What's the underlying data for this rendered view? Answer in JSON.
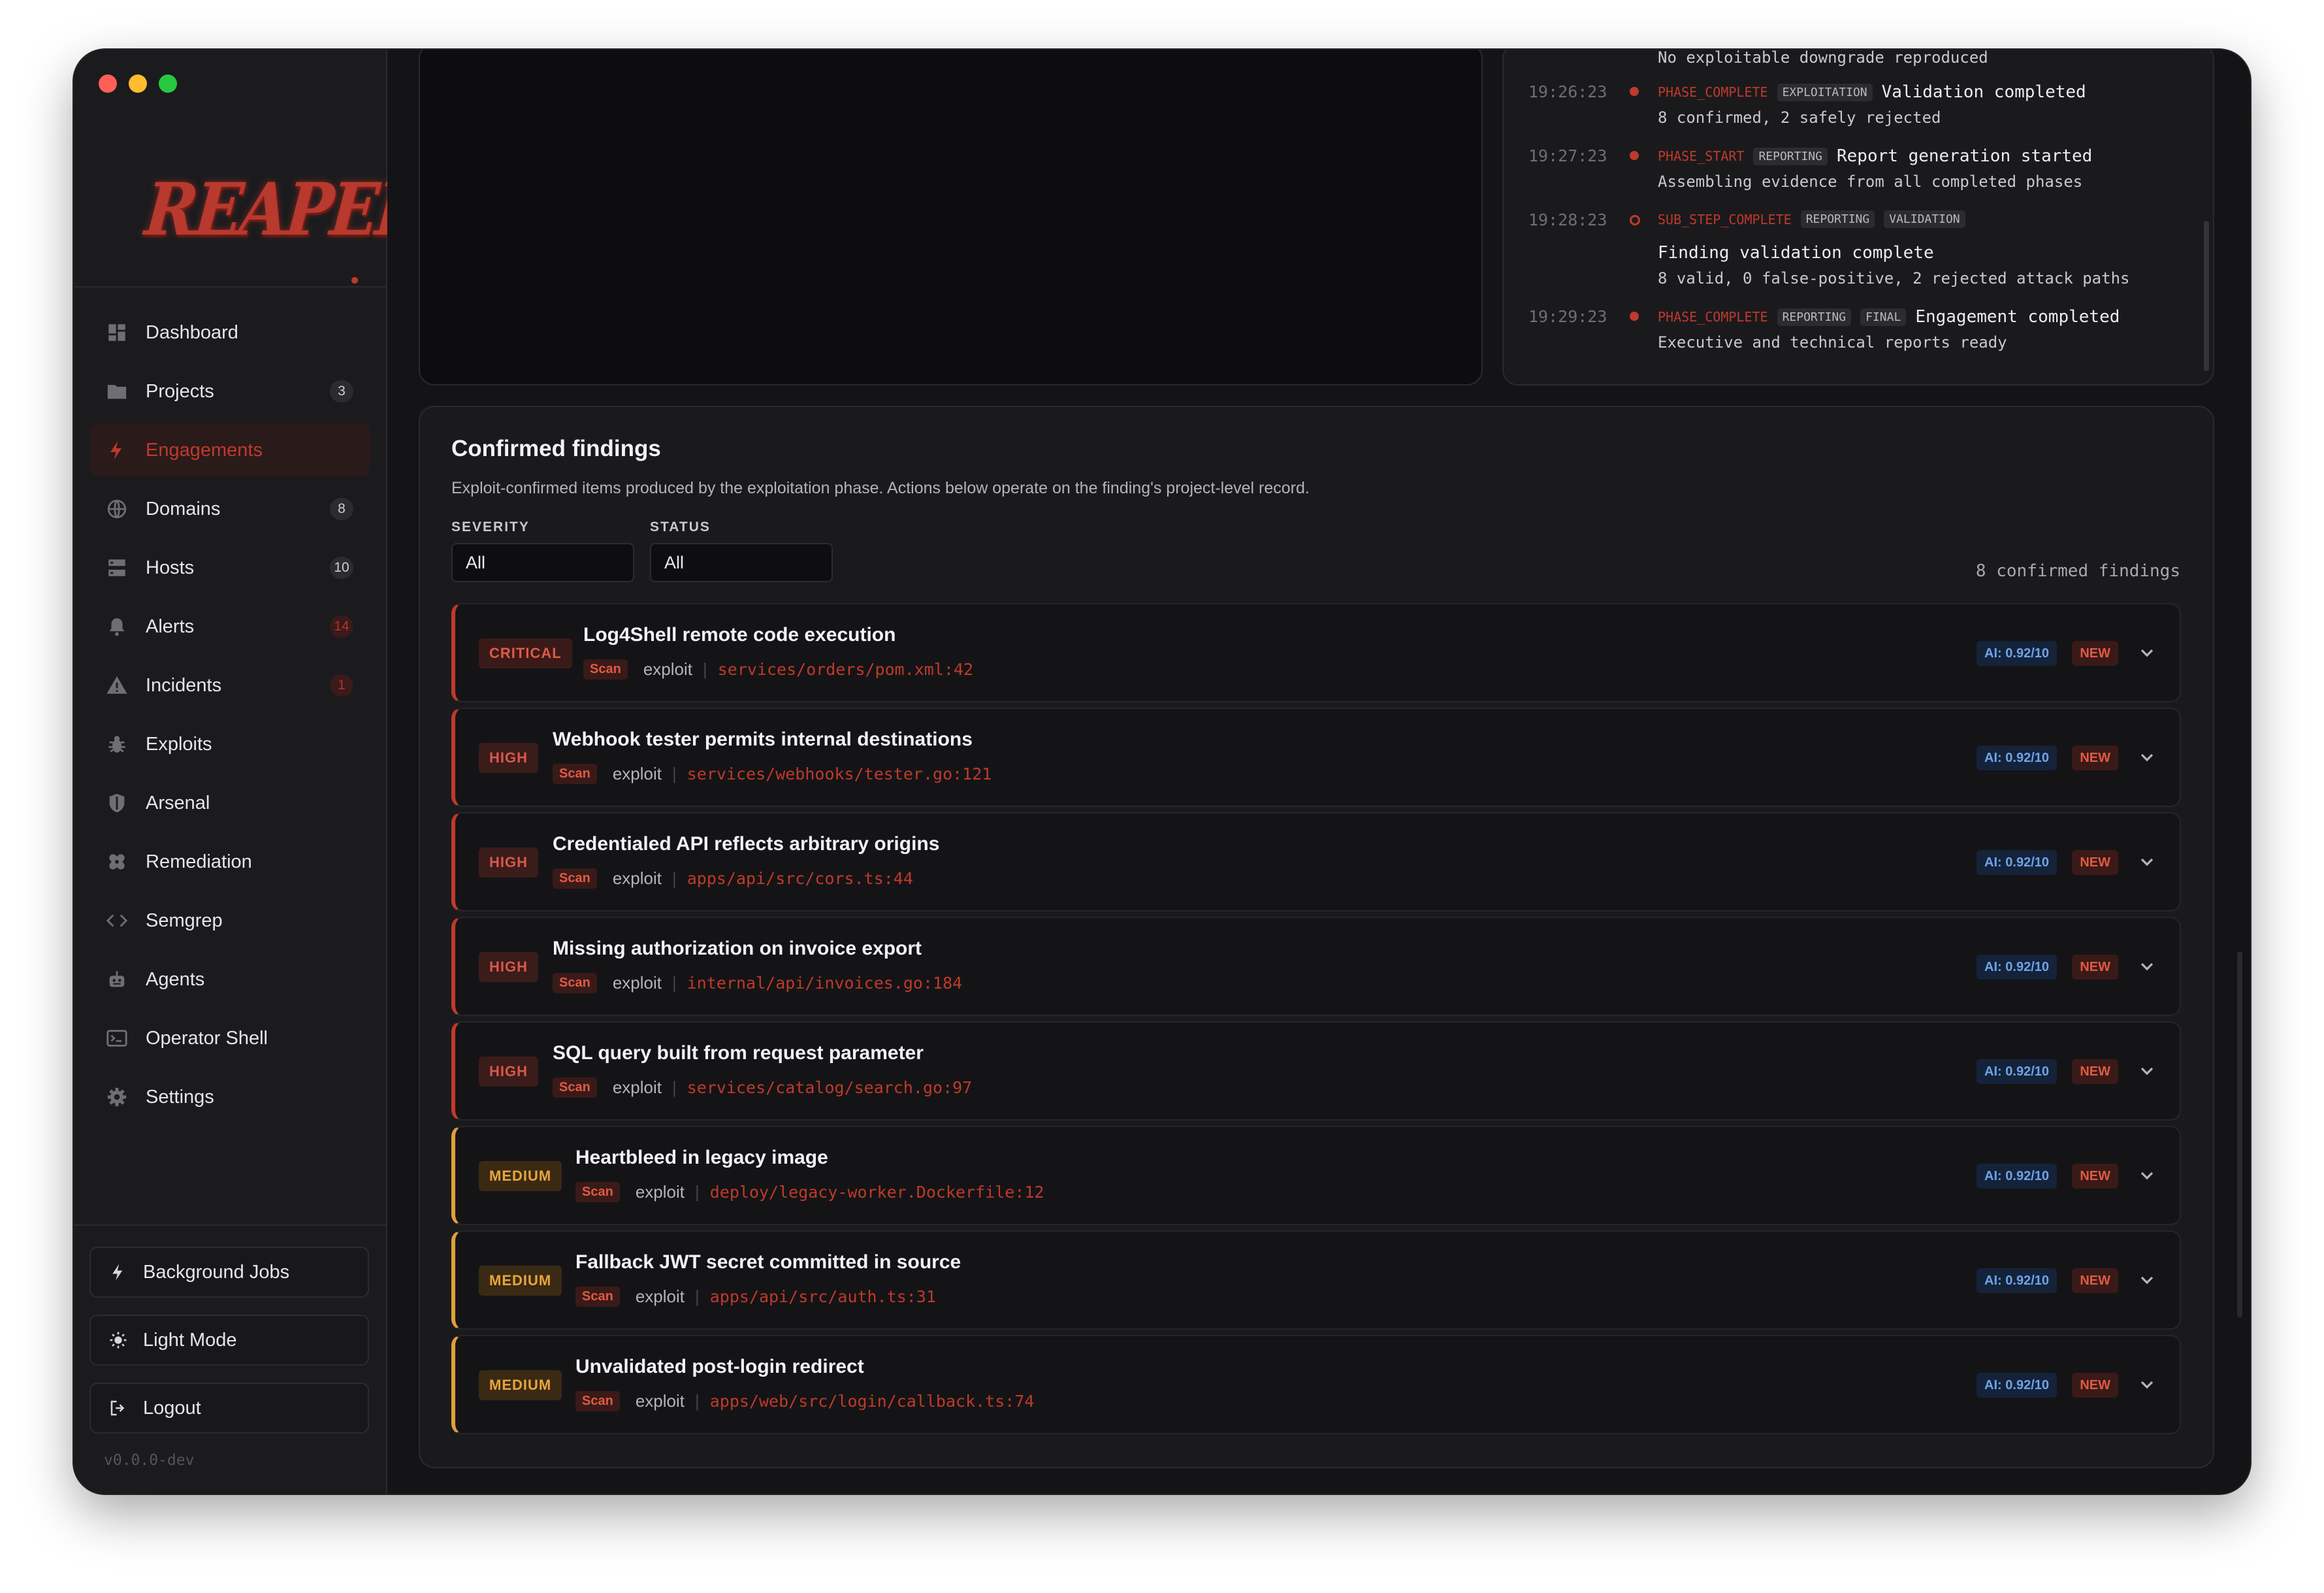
{
  "sidebar": {
    "logo_text": "REAPER",
    "items": [
      {
        "label": "Dashboard",
        "icon": "dashboard-icon",
        "badge": ""
      },
      {
        "label": "Projects",
        "icon": "folder-icon",
        "badge": "3"
      },
      {
        "label": "Engagements",
        "icon": "lightning-icon",
        "badge": "",
        "active": true
      },
      {
        "label": "Domains",
        "icon": "globe-icon",
        "badge": "8"
      },
      {
        "label": "Hosts",
        "icon": "server-icon",
        "badge": "10"
      },
      {
        "label": "Alerts",
        "icon": "bell-icon",
        "badge": "14"
      },
      {
        "label": "Incidents",
        "icon": "warning-icon",
        "badge": "1"
      },
      {
        "label": "Exploits",
        "icon": "bug-icon",
        "badge": ""
      },
      {
        "label": "Arsenal",
        "icon": "shield-icon",
        "badge": ""
      },
      {
        "label": "Remediation",
        "icon": "bandage-icon",
        "badge": ""
      },
      {
        "label": "Semgrep",
        "icon": "code-icon",
        "badge": ""
      },
      {
        "label": "Agents",
        "icon": "robot-icon",
        "badge": ""
      },
      {
        "label": "Operator Shell",
        "icon": "terminal-icon",
        "badge": ""
      },
      {
        "label": "Settings",
        "icon": "gear-icon",
        "badge": ""
      }
    ],
    "bottom": {
      "background_jobs": "Background Jobs",
      "light_mode": "Light Mode",
      "logout": "Logout"
    },
    "version": "v0.0.0-dev"
  },
  "event_log": {
    "top_detail": "No exploitable downgrade reproduced",
    "entries": [
      {
        "time": "19:26:23",
        "type": "PHASE_COMPLETE",
        "tags": [
          "EXPLOITATION"
        ],
        "message": "Validation completed",
        "detail": "8 confirmed, 2 safely rejected"
      },
      {
        "time": "19:27:23",
        "type": "PHASE_START",
        "tags": [
          "REPORTING"
        ],
        "message": "Report generation started",
        "detail": "Assembling evidence from all completed phases"
      },
      {
        "time": "19:28:23",
        "type": "SUB_STEP_COMPLETE",
        "tags": [
          "REPORTING",
          "VALIDATION"
        ],
        "message": "Finding validation complete",
        "detail": "8 valid, 0 false-positive, 2 rejected attack paths"
      },
      {
        "time": "19:29:23",
        "type": "PHASE_COMPLETE",
        "tags": [
          "REPORTING",
          "FINAL"
        ],
        "message": "Engagement completed",
        "detail": "Executive and technical reports ready"
      }
    ]
  },
  "findings": {
    "title": "Confirmed findings",
    "subtitle": "Exploit-confirmed items produced by the exploitation phase. Actions below operate on the finding's project-level record.",
    "filters": {
      "severity_label": "SEVERITY",
      "severity_value": "All",
      "status_label": "STATUS",
      "status_value": "All"
    },
    "count_text": "8 confirmed findings",
    "items": [
      {
        "severity": "CRITICAL",
        "title": "Log4Shell remote code execution",
        "source": "Scan",
        "kind": "exploit",
        "path": "services/orders/pom.xml:42",
        "ai": "AI: 0.92/10",
        "status": "NEW"
      },
      {
        "severity": "HIGH",
        "title": "Webhook tester permits internal destinations",
        "source": "Scan",
        "kind": "exploit",
        "path": "services/webhooks/tester.go:121",
        "ai": "AI: 0.92/10",
        "status": "NEW"
      },
      {
        "severity": "HIGH",
        "title": "Credentialed API reflects arbitrary origins",
        "source": "Scan",
        "kind": "exploit",
        "path": "apps/api/src/cors.ts:44",
        "ai": "AI: 0.92/10",
        "status": "NEW"
      },
      {
        "severity": "HIGH",
        "title": "Missing authorization on invoice export",
        "source": "Scan",
        "kind": "exploit",
        "path": "internal/api/invoices.go:184",
        "ai": "AI: 0.92/10",
        "status": "NEW"
      },
      {
        "severity": "HIGH",
        "title": "SQL query built from request parameter",
        "source": "Scan",
        "kind": "exploit",
        "path": "services/catalog/search.go:97",
        "ai": "AI: 0.92/10",
        "status": "NEW"
      },
      {
        "severity": "MEDIUM",
        "title": "Heartbleed in legacy image",
        "source": "Scan",
        "kind": "exploit",
        "path": "deploy/legacy-worker.Dockerfile:12",
        "ai": "AI: 0.92/10",
        "status": "NEW"
      },
      {
        "severity": "MEDIUM",
        "title": "Fallback JWT secret committed in source",
        "source": "Scan",
        "kind": "exploit",
        "path": "apps/api/src/auth.ts:31",
        "ai": "AI: 0.92/10",
        "status": "NEW"
      },
      {
        "severity": "MEDIUM",
        "title": "Unvalidated post-login redirect",
        "source": "Scan",
        "kind": "exploit",
        "path": "apps/web/src/login/callback.ts:74",
        "ai": "AI: 0.92/10",
        "status": "NEW"
      }
    ]
  },
  "colors": {
    "accent": "#c0392b",
    "critical": "#e05a45",
    "high": "#d8594a",
    "medium": "#e8a53d",
    "ai": "#6fa3e8"
  }
}
